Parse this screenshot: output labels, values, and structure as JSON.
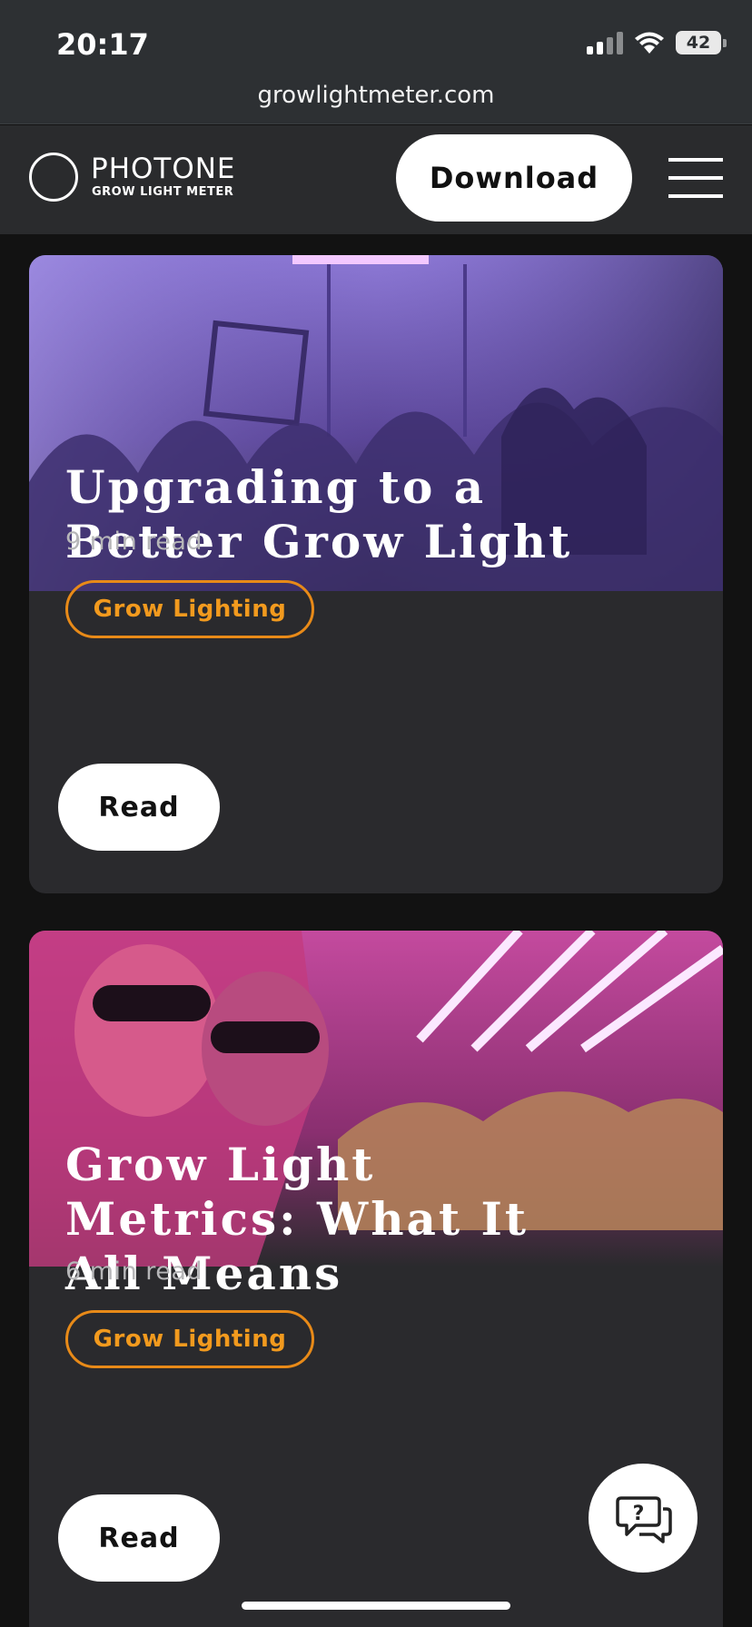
{
  "status_bar": {
    "time": "20:17",
    "battery": "42"
  },
  "browser": {
    "url": "growlightmeter.com"
  },
  "header": {
    "logo_name": "PHOTONE",
    "logo_sub": "GROW LIGHT METER",
    "download_label": "Download"
  },
  "articles": [
    {
      "title": "Upgrading to a\nBetter Grow Light",
      "read_time": "9 min read",
      "tag": "Grow Lighting",
      "read_label": "Read"
    },
    {
      "title": "Grow Light\nMetrics: What It\nAll Means",
      "read_time": "6 min read",
      "tag": "Grow Lighting",
      "read_label": "Read"
    }
  ],
  "colors": {
    "accent_tag": "#e88a18",
    "card_bg": "#2a2a2d",
    "header_bg": "#2a2b2d"
  },
  "icons": [
    "signal-icon",
    "wifi-icon",
    "battery-icon",
    "menu-icon",
    "help-chat-icon"
  ]
}
